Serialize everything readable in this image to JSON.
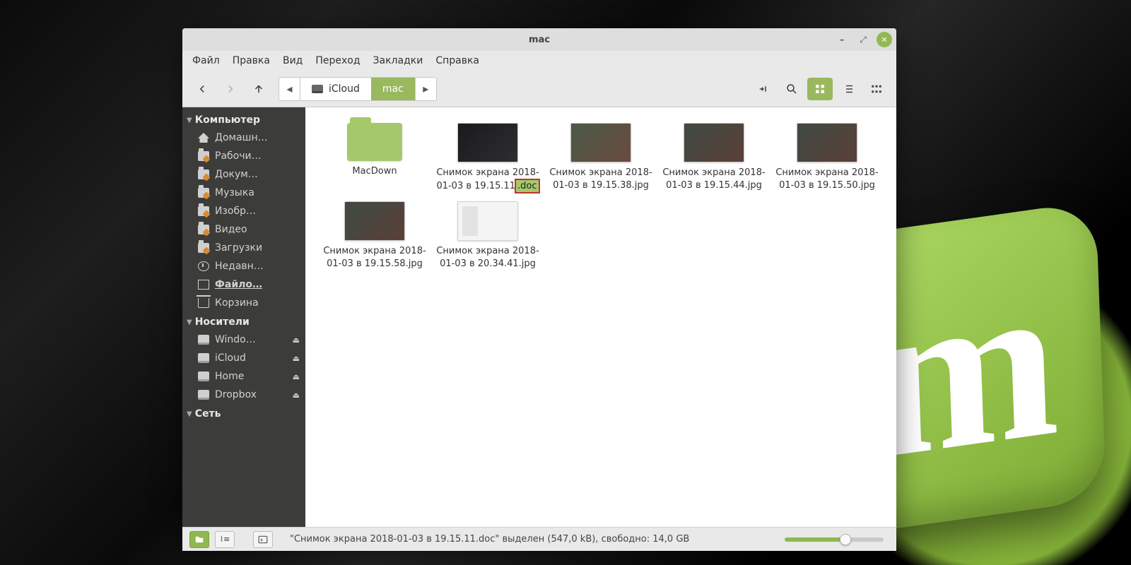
{
  "window": {
    "title": "mac"
  },
  "menubar": [
    "Файл",
    "Правка",
    "Вид",
    "Переход",
    "Закладки",
    "Справка"
  ],
  "breadcrumb": {
    "segments": [
      {
        "label": "iCloud",
        "active": false,
        "icon": "drive"
      },
      {
        "label": "mac",
        "active": true
      }
    ]
  },
  "sidebar": {
    "sections": [
      {
        "title": "Компьютер",
        "items": [
          {
            "label": "Домашн…",
            "icon": "home"
          },
          {
            "label": "Рабочи…",
            "icon": "folder",
            "warn": true
          },
          {
            "label": "Докум…",
            "icon": "folder",
            "warn": true
          },
          {
            "label": "Музыка",
            "icon": "folder",
            "warn": true
          },
          {
            "label": "Изобр…",
            "icon": "folder",
            "warn": true
          },
          {
            "label": "Видео",
            "icon": "folder",
            "warn": true
          },
          {
            "label": "Загрузки",
            "icon": "folder",
            "warn": true
          },
          {
            "label": "Недавн…",
            "icon": "clock"
          },
          {
            "label": "Файло…",
            "icon": "fs",
            "active": true
          },
          {
            "label": "Корзина",
            "icon": "trash"
          }
        ]
      },
      {
        "title": "Носители",
        "items": [
          {
            "label": "Windo…",
            "icon": "drive",
            "eject": true
          },
          {
            "label": "iCloud",
            "icon": "drive",
            "eject": true
          },
          {
            "label": "Home",
            "icon": "drive",
            "eject": true
          },
          {
            "label": "Dropbox",
            "icon": "drive",
            "eject": true
          }
        ]
      },
      {
        "title": "Сеть",
        "items": []
      }
    ]
  },
  "files": [
    {
      "name": "MacDown",
      "type": "folder"
    },
    {
      "name_base": "Снимок экрана 2018-01-03 в 19.15.11",
      "ext": ".doc",
      "type": "image",
      "thumb": "dark",
      "renaming": true
    },
    {
      "name": "Снимок экрана 2018-01-03 в 19.15.38.jpg",
      "type": "image",
      "thumb": "blur1"
    },
    {
      "name": "Снимок экрана 2018-01-03 в 19.15.44.jpg",
      "type": "image",
      "thumb": "blur2"
    },
    {
      "name": "Снимок экрана 2018-01-03 в 19.15.50.jpg",
      "type": "image",
      "thumb": "blur2"
    },
    {
      "name": "Снимок экрана 2018-01-03 в 19.15.58.jpg",
      "type": "image",
      "thumb": "blur2"
    },
    {
      "name": "Снимок экрана 2018-01-03 в 20.34.41.jpg",
      "type": "image",
      "thumb": "light"
    }
  ],
  "statusbar": {
    "text": "\"Снимок экрана 2018-01-03 в 19.15.11.doc\" выделен (547,0 kB), свободно: 14,0 GB"
  }
}
